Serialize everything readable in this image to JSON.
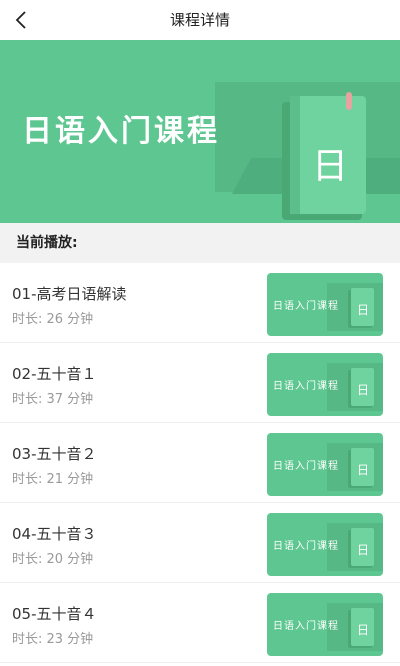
{
  "header": {
    "title": "课程详情",
    "back_icon": "chevron-left-icon"
  },
  "banner": {
    "text": "日语入门课程",
    "book_glyph": "日",
    "colors": {
      "background": "#5ec690",
      "book": "#6fd39f"
    }
  },
  "section": {
    "label": "当前播放:"
  },
  "lessons": [
    {
      "title": "01-高考日语解读",
      "duration": "时长: 26 分钟",
      "thumb_text": "日语入门课程",
      "thumb_glyph": "日"
    },
    {
      "title": "02-五十音１",
      "duration": "时长: 37 分钟",
      "thumb_text": "日语入门课程",
      "thumb_glyph": "日"
    },
    {
      "title": "03-五十音２",
      "duration": "时长: 21 分钟",
      "thumb_text": "日语入门课程",
      "thumb_glyph": "日"
    },
    {
      "title": "04-五十音３",
      "duration": "时长: 20 分钟",
      "thumb_text": "日语入门课程",
      "thumb_glyph": "日"
    },
    {
      "title": "05-五十音４",
      "duration": "时长: 23 分钟",
      "thumb_text": "日语入门课程",
      "thumb_glyph": "日"
    }
  ]
}
